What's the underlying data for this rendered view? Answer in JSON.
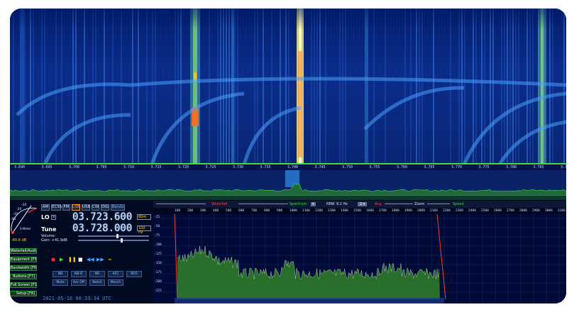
{
  "colors": {
    "waterfall_bg": "#0b2d8c",
    "signal_strong": "#ff3a10",
    "signal_green": "#3fdc3a",
    "accent_orange": "#ff9a2a",
    "spectrum_fill": "#2e7a2a",
    "filter_edge": "#ff3a20"
  },
  "freq_axis": {
    "ticks": [
      "3.690",
      "3.695",
      "3.700",
      "3.705",
      "3.710",
      "3.715",
      "3.720",
      "3.725",
      "3.730",
      "3.735",
      "3.740",
      "3.745",
      "3.750",
      "3.755",
      "3.760",
      "3.765",
      "3.770",
      "3.775",
      "3.780",
      "3.785",
      "3.790"
    ]
  },
  "smeter": {
    "scale": [
      "-10",
      "-20",
      "-30",
      "-40"
    ],
    "label": "S-Meter",
    "value": "-80.6 dB"
  },
  "side_buttons": [
    {
      "label": "Waterfall/Audio [W]",
      "icon": "waterfall-icon"
    },
    {
      "label": "Equipment [F5]",
      "icon": "equipment-icon"
    },
    {
      "label": "Bandwidth [F6]",
      "icon": "bandwidth-icon"
    },
    {
      "label": "Buttons [F7]",
      "icon": "buttons-icon"
    },
    {
      "label": "Full Screen [F11]",
      "icon": "fullscreen-icon"
    },
    {
      "label": "Setup [F8]",
      "icon": "setup-icon"
    }
  ],
  "modes": {
    "items": [
      "AM",
      "ECSS",
      "FM",
      "LSB",
      "USB",
      "CW",
      "DIG"
    ],
    "active": "LSB",
    "band_button": "Bands"
  },
  "lo": {
    "label": "LO",
    "value": "03.723.600",
    "step": "80m"
  },
  "tune": {
    "label": "Tune",
    "value": "03.728.000",
    "step": "100 Hz"
  },
  "volume": {
    "label": "Volume:"
  },
  "gain": {
    "label": "Gain: +41.9dB"
  },
  "transport_icons": [
    "record-icon",
    "play-icon",
    "pause-icon",
    "stop-icon",
    "rewind-icon",
    "fast-forward-icon",
    "loop-icon"
  ],
  "dsp_buttons": [
    {
      "label": "NB"
    },
    {
      "label": "NB IF"
    },
    {
      "label": "NR"
    },
    {
      "label": "AFC"
    },
    {
      "label": "BFO"
    },
    {
      "label": "Mute"
    },
    {
      "label": "Asc Off"
    },
    {
      "label": "Notch"
    },
    {
      "label": "Msnch"
    }
  ],
  "datetime": "2021-05-16 08:33:34 UTC",
  "spectrum_toolbar": {
    "waterfall": "Waterfall",
    "spectrum": "Spectrum",
    "rbw_label": "RBW",
    "rbw_value": "9.2 Hz",
    "avg": "Avg",
    "zoom": "Zoom",
    "speed": "Speed"
  },
  "spectrum_axis": {
    "ticks": [
      "100",
      "200",
      "300",
      "400",
      "500",
      "600",
      "700",
      "800",
      "900",
      "1000",
      "1100",
      "1200",
      "1300",
      "1400",
      "1500",
      "1600",
      "1700",
      "1800",
      "1900",
      "2000",
      "2100",
      "2200",
      "2300",
      "2400",
      "2500",
      "2600",
      "2700",
      "2800",
      "2900",
      "3000",
      "3100"
    ]
  },
  "db_axis": {
    "ticks": [
      "-25",
      "-50",
      "-75",
      "-100",
      "-125",
      "-150",
      "-175",
      "-200",
      "-225"
    ]
  }
}
